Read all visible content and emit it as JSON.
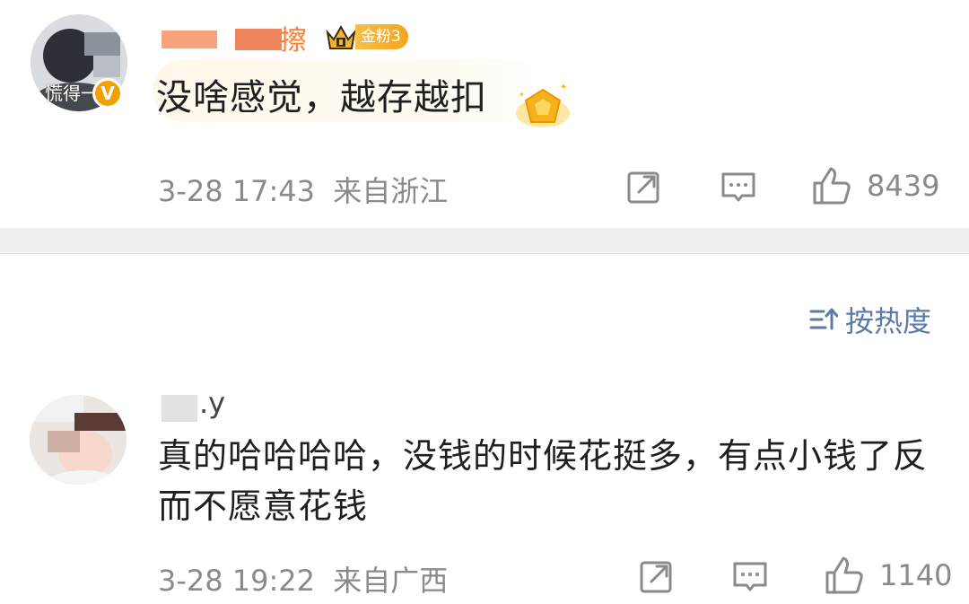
{
  "comment1": {
    "author_visible_suffix": "擦",
    "avatar_overlay_text": "慌得一",
    "verified_mark": "V",
    "fan_badge": "金粉3",
    "text": "没啥感觉，越存越扣",
    "timestamp": "3-28 17:43",
    "location": "来自浙江",
    "like_count": "8439",
    "icons": [
      "avatar",
      "verified-icon",
      "crown-icon",
      "star-badge-icon",
      "share-icon",
      "comment-icon",
      "like-icon"
    ]
  },
  "sort": {
    "label": "按热度",
    "icon": "sort-icon"
  },
  "comment2": {
    "author_visible_suffix": ".y",
    "text": "真的哈哈哈哈，没钱的时候花挺多，有点小钱了反而不愿意花钱",
    "timestamp": "3-28 19:22",
    "location": "来自广西",
    "like_count": "1140",
    "icons": [
      "avatar",
      "share-icon",
      "comment-icon",
      "like-icon"
    ]
  },
  "colors": {
    "accent_orange": "#ff7a2a",
    "badge_gold": "#f3a51a",
    "sort_blue": "#5b7aa8",
    "meta_gray": "#8a8a8a"
  }
}
